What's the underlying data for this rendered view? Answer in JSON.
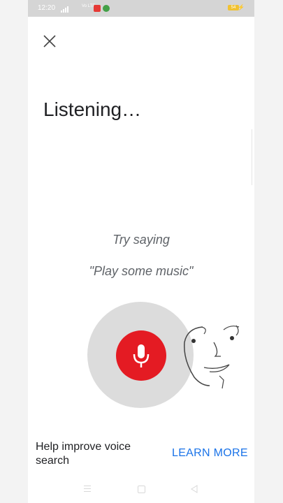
{
  "status_bar": {
    "time": "12:20",
    "network": "Vo LTE",
    "battery": "54"
  },
  "voice_search": {
    "status": "Listening…",
    "prompt": "Try saying",
    "suggestion": "\"Play some music\"",
    "help_text": "Help improve voice search",
    "learn_more": "LEARN MORE"
  },
  "colors": {
    "mic": "#e41b23",
    "link": "#1a73e8"
  },
  "icons": {
    "close": "close-icon",
    "mic": "microphone-icon",
    "face": "doodle-face-icon"
  }
}
